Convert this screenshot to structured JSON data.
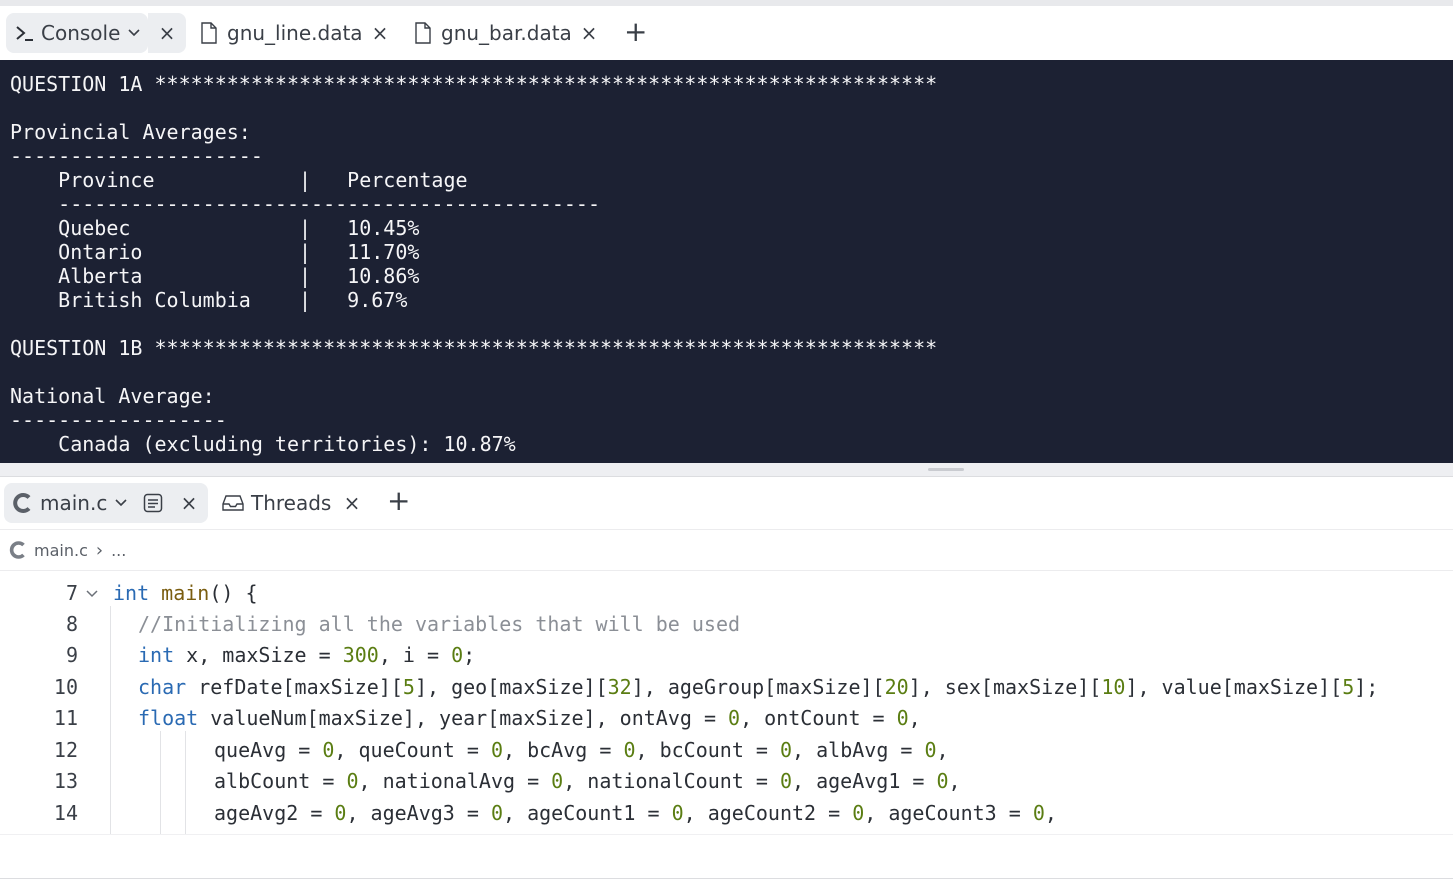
{
  "top_tabs": [
    {
      "label": "Console",
      "icon": "terminal-prompt-icon"
    },
    {
      "label": "gnu_line.data",
      "icon": "file-icon"
    },
    {
      "label": "gnu_bar.data",
      "icon": "file-icon"
    }
  ],
  "top_close_glyph": "×",
  "add_tab_glyph": "+",
  "console_lines": [
    "QUESTION 1A *****************************************************************",
    "",
    "Provincial Averages:",
    "---------------------",
    "    Province            |   Percentage",
    "    ---------------------------------------------",
    "    Quebec              |   10.45%",
    "    Ontario             |   11.70%",
    "    Alberta             |   10.86%",
    "    British Columbia    |   9.67%",
    "",
    "QUESTION 1B *****************************************************************",
    "",
    "National Average:",
    "------------------",
    "    Canada (excluding territories): 10.87%"
  ],
  "editor_tabs": [
    {
      "label": "main.c",
      "icon": "c-language-icon"
    },
    {
      "label": "Threads",
      "icon": "inbox-icon"
    }
  ],
  "breadcrumb": {
    "file": "main.c",
    "separator": "›",
    "more": "..."
  },
  "code": {
    "line_numbers": [
      "7",
      "8",
      "9",
      "10",
      "11",
      "12",
      "13",
      "14"
    ],
    "tokens": [
      [
        [
          "kw",
          "int"
        ],
        [
          "",
          ""
        ],
        [
          "fn",
          " main"
        ],
        [
          "",
          "() {"
        ]
      ],
      [
        [
          "cm",
          "//Initializing all the variables that will be used"
        ]
      ],
      [
        [
          "kw",
          "int"
        ],
        [
          "",
          " x, maxSize = "
        ],
        [
          "nm",
          "300"
        ],
        [
          "",
          ", i = "
        ],
        [
          "nm",
          "0"
        ],
        [
          "",
          ";"
        ]
      ],
      [
        [
          "kw",
          "char"
        ],
        [
          "",
          " refDate[maxSize]["
        ],
        [
          "nm",
          "5"
        ],
        [
          "",
          "], geo[maxSize]["
        ],
        [
          "nm",
          "32"
        ],
        [
          "",
          "], ageGroup[maxSize]["
        ],
        [
          "nm",
          "20"
        ],
        [
          "",
          "], sex[maxSize]["
        ],
        [
          "nm",
          "10"
        ],
        [
          "",
          "], value[maxSize]["
        ],
        [
          "nm",
          "5"
        ],
        [
          "",
          "];"
        ]
      ],
      [
        [
          "kw",
          "float"
        ],
        [
          "",
          " valueNum[maxSize], year[maxSize], ontAvg = "
        ],
        [
          "nm",
          "0"
        ],
        [
          "",
          ", ontCount = "
        ],
        [
          "nm",
          "0"
        ],
        [
          "",
          ","
        ]
      ],
      [
        [
          "",
          "queAvg = "
        ],
        [
          "nm",
          "0"
        ],
        [
          "",
          ", queCount = "
        ],
        [
          "nm",
          "0"
        ],
        [
          "",
          ", bcAvg = "
        ],
        [
          "nm",
          "0"
        ],
        [
          "",
          ", bcCount = "
        ],
        [
          "nm",
          "0"
        ],
        [
          "",
          ", albAvg = "
        ],
        [
          "nm",
          "0"
        ],
        [
          "",
          ","
        ]
      ],
      [
        [
          "",
          "albCount = "
        ],
        [
          "nm",
          "0"
        ],
        [
          "",
          ", nationalAvg = "
        ],
        [
          "nm",
          "0"
        ],
        [
          "",
          ", nationalCount = "
        ],
        [
          "nm",
          "0"
        ],
        [
          "",
          ", ageAvg1 = "
        ],
        [
          "nm",
          "0"
        ],
        [
          "",
          ","
        ]
      ],
      [
        [
          "",
          "ageAvg2 = "
        ],
        [
          "nm",
          "0"
        ],
        [
          "",
          ", ageAvg3 = "
        ],
        [
          "nm",
          "0"
        ],
        [
          "",
          ", ageCount1 = "
        ],
        [
          "nm",
          "0"
        ],
        [
          "",
          ", ageCount2 = "
        ],
        [
          "nm",
          "0"
        ],
        [
          "",
          ", ageCount3 = "
        ],
        [
          "nm",
          "0"
        ],
        [
          "",
          ","
        ]
      ]
    ]
  },
  "colors": {
    "console_bg": "#1c2133",
    "keyword": "#2a6ab3",
    "number": "#5a7d12",
    "comment": "#8b8f96",
    "function": "#7a5d10"
  }
}
